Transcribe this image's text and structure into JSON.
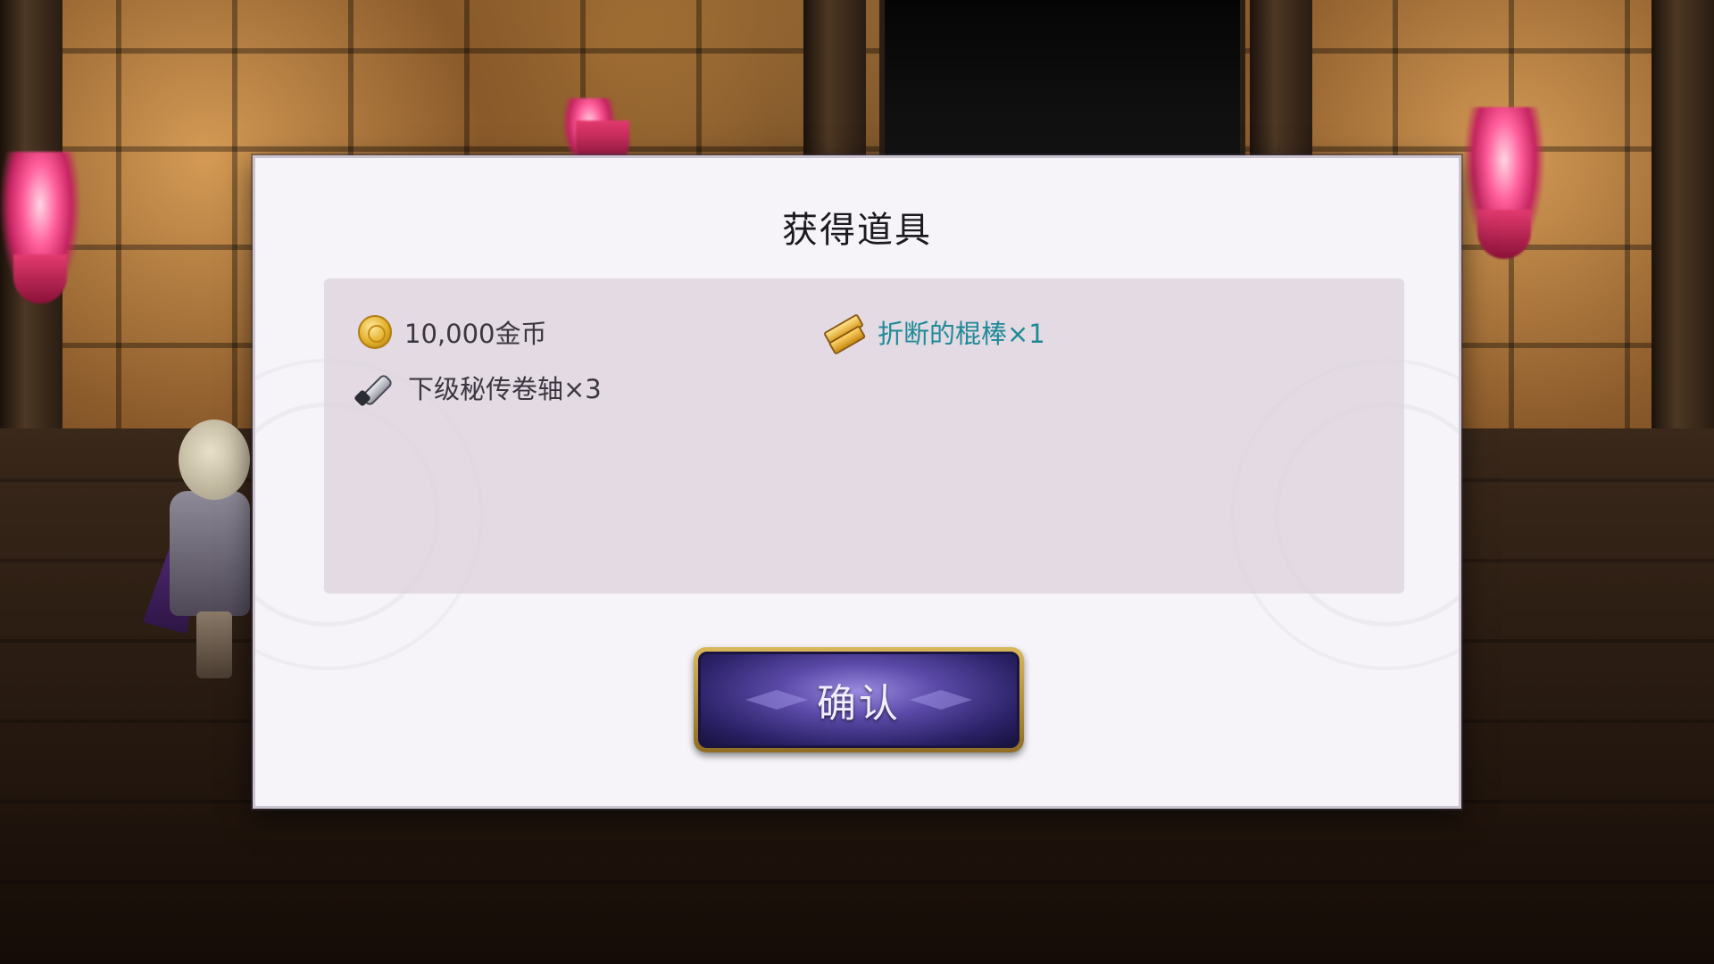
{
  "dialog": {
    "title": "获得道具",
    "confirm_label": "确认"
  },
  "rewards": [
    {
      "icon": "gold-coin-icon",
      "label": "10,000金币",
      "rarity": "normal"
    },
    {
      "icon": "broken-stick-icon",
      "label": "折断的棍棒×1",
      "rarity": "rare"
    },
    {
      "icon": "scroll-icon",
      "label": "下级秘传卷轴×3",
      "rarity": "normal"
    }
  ],
  "colors": {
    "normal_text": "#3b3740",
    "rare_text": "#1e8a96",
    "button_fill": "#3a2f86",
    "button_frame": "#c9a548",
    "torch_flame": "#ff5c9a"
  }
}
